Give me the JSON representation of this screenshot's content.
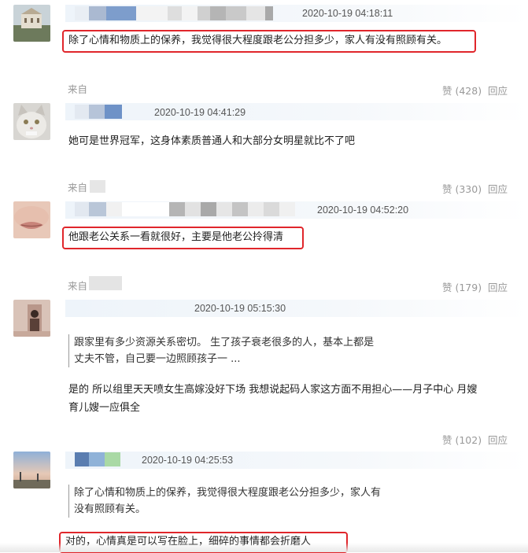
{
  "comments": [
    {
      "timestamp": "2020-10-19 04:18:11",
      "text": "除了心情和物质上的保养，我觉得很大程度跟老公分担多少，家人有没有照顾有关。",
      "source_label": "来自",
      "likes": "赞 (428)",
      "reply": "回应"
    },
    {
      "timestamp": "2020-10-19 04:41:29",
      "text": "她可是世界冠军，这身体素质普通人和大部分女明星就比不了吧",
      "source_label": "来自",
      "likes": "赞 (330)",
      "reply": "回应"
    },
    {
      "timestamp": "2020-10-19 04:52:20",
      "text": "他跟老公关系一看就很好，主要是他老公拎得清",
      "source_label": "来自",
      "likes": "赞 (179)",
      "reply": "回应"
    },
    {
      "timestamp": "2020-10-19 05:15:30",
      "quote_line1": "跟家里有多少资源关系密切。 生了孩子衰老很多的人，基本上都是",
      "quote_line2": "丈夫不管，自己要一边照顾孩子一 ...",
      "text_line1": "是的 所以组里天天喷女生高嫁没好下场 我想说起码人家这方面不用担心——月子中心 月嫂",
      "text_line2": "育儿嫂一应俱全",
      "likes": "赞 (102)",
      "reply": "回应"
    },
    {
      "timestamp": "2020-10-19 04:25:53",
      "quote_line1": "除了心情和物质上的保养，我觉得很大程度跟老公分担多少，家人有",
      "quote_line2": "没有照顾有关。",
      "text": "对的，心情真是可以写在脸上，细碎的事情都会折磨人"
    }
  ],
  "colors": {
    "highlight_border": "#e0262b",
    "meta_text": "#999999",
    "blur_blue": "#5b86c4",
    "blur_green": "#a8d5a2"
  }
}
